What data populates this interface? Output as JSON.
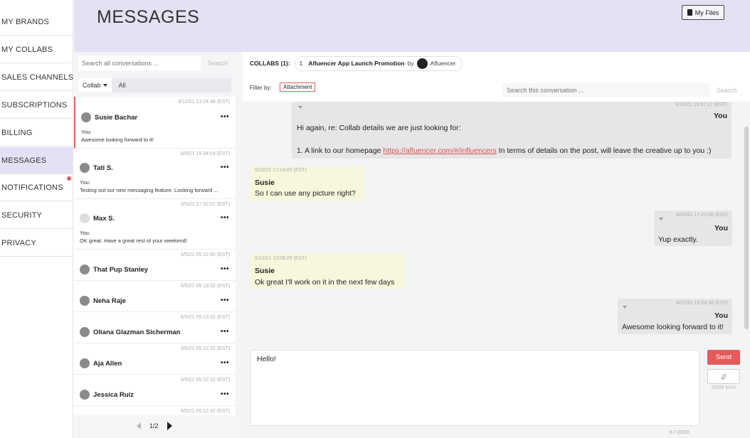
{
  "sidebar": {
    "items": [
      {
        "label": "MY BRANDS"
      },
      {
        "label": "MY COLLABS"
      },
      {
        "label": "SALES CHANNELS"
      },
      {
        "label": "SUBSCRIPTIONS"
      },
      {
        "label": "BILLING"
      },
      {
        "label": "MESSAGES",
        "active": true
      },
      {
        "label": "NOTIFICATIONS",
        "has_alert": true
      },
      {
        "label": "SECURITY"
      },
      {
        "label": "PRIVACY"
      }
    ]
  },
  "header": {
    "title": "MESSAGES",
    "my_files_label": "My Files"
  },
  "conversations": {
    "search_placeholder": "Search all conversations ...",
    "search_button": "Search",
    "filter_dropdown": "Collab",
    "filter_value": "All",
    "items": [
      {
        "name": "Susie Bachar",
        "time": "6/12/21 13:24:38 (EST)",
        "you": "You:",
        "preview": "Awesome looking forward to it!",
        "selected": true
      },
      {
        "name": "Tati S.",
        "time": "6/9/21 15:34:54 (EST)",
        "you": "You:",
        "preview": "Testing out our new messaging feature. Looking forward ..."
      },
      {
        "name": "Max S.",
        "time": "6/5/21 17:32:01 (EST)",
        "you": "You:",
        "preview": "OK great. Have a great rest of your weekend!"
      },
      {
        "name": "That Pup Stanley",
        "time": "6/5/21 05:12:30 (EST)"
      },
      {
        "name": "Neha Raje",
        "time": "6/5/21 05:13:32 (EST)"
      },
      {
        "name": "Oliana Glazman Sicherman",
        "time": "6/5/21 05:13:32 (EST)"
      },
      {
        "name": "Aja Allen",
        "time": "6/5/21 05:12:32 (EST)"
      },
      {
        "name": "Jessica Ruiz",
        "time": "6/5/21 05:12:32 (EST)"
      },
      {
        "name": "",
        "time": "6/5/21 05:12:32 (EST)"
      }
    ],
    "more_label": "•••",
    "pager": "1/2"
  },
  "chat": {
    "collabs_label": "COLLABS (1):",
    "collab_number": "1",
    "collab_title": "Afluencer App Launch Promotion",
    "collab_by": "by",
    "collab_brand": "Afluencer",
    "filter_by_label": "Filter by:",
    "attachment_chip": "Attachment",
    "conv_search_placeholder": "Search this conversation ...",
    "conv_search_button": "Search",
    "messages": [
      {
        "type": "mine",
        "time": "6/10/21 16:57:17 (EST)",
        "sender": "You",
        "line1": "Hi again, re: Collab details we are just looking for:",
        "line2_prefix": "1. A link to our homepage ",
        "line2_link": "https://afluencer.com/#/influencers",
        "line2_suffix": " In terms of details on the post, will leave the creative up to you :)"
      },
      {
        "type": "theirs",
        "time": "6/10/21 17:14:05 (EST)",
        "sender": "Susie",
        "text": "So I can use any picture right?"
      },
      {
        "type": "mine",
        "time": "6/10/21 17:21:36 (EST)",
        "sender": "You",
        "text": "Yup exactly."
      },
      {
        "type": "theirs",
        "time": "6/12/21 10:06:29 (EST)",
        "sender": "Susie",
        "text": "Ok great I'll work on it in the next few days"
      },
      {
        "type": "mine",
        "time": "6/12/21 13:24:38 (EST)",
        "sender": "You",
        "text": "Awesome looking forward to it!"
      }
    ],
    "compose_value": "Hello!",
    "send_label": "Send",
    "max_size_label": "20MB MAX",
    "char_count": "6 / 2000"
  },
  "colors": {
    "accent": "#e35b5b",
    "header_bg": "#e3e2f4",
    "mine_bubble": "#e6e6e9",
    "theirs_bubble": "#f6f7dc"
  }
}
